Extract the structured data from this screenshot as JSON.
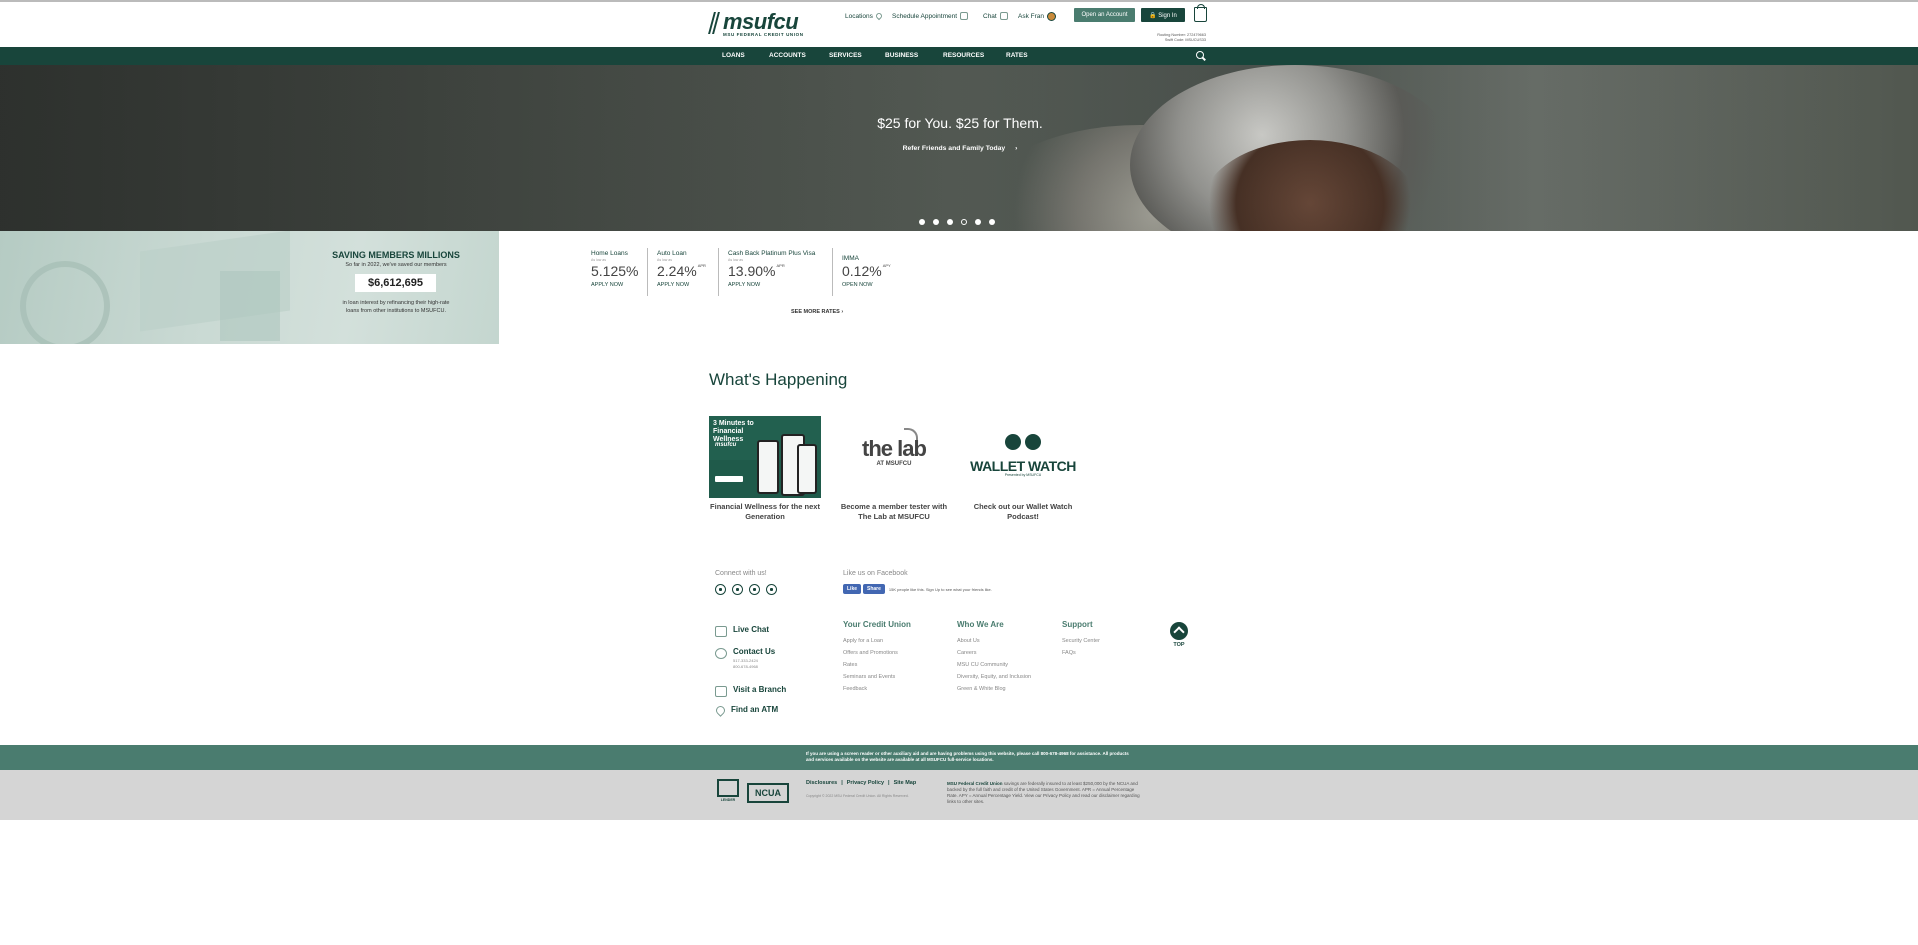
{
  "header": {
    "logo_word": "msufcu",
    "logo_sub": "MSU FEDERAL CREDIT UNION",
    "util": {
      "locations": "Locations",
      "schedule": "Schedule Appointment",
      "chat": "Chat",
      "ask_fran": "Ask Fran"
    },
    "open_account": "Open an Account",
    "sign_in": "🔒 Sign In",
    "routing": "Routing Number: 272479663",
    "swift": "Swift Code: MSUCUS33"
  },
  "nav": {
    "items": [
      "LOANS",
      "ACCOUNTS",
      "SERVICES",
      "BUSINESS",
      "RESOURCES",
      "RATES"
    ]
  },
  "hero": {
    "title": "$25 for You. $25 for Them.",
    "cta": "Refer Friends and Family Today",
    "cta_arrow": "›",
    "slides": 6,
    "active_slide": 4
  },
  "savings": {
    "title": "SAVING MEMBERS MILLIONS",
    "subtitle": "So far in 2022, we've saved our members",
    "amount": "$6,612,695",
    "description": "in loan interest by refinancing their high-rate loans from other institutions to MSUFCU."
  },
  "rates": [
    {
      "name": "Home Loans",
      "as_low_as": "As low as",
      "value": "5.125%",
      "suffix": "",
      "action": "APPLY NOW"
    },
    {
      "name": "Auto Loan",
      "as_low_as": "As low as",
      "value": "2.24%",
      "suffix": "APR",
      "action": "APPLY NOW"
    },
    {
      "name": "Cash Back Platinum Plus Visa",
      "as_low_as": "As low as",
      "value": "13.90%",
      "suffix": "APR",
      "action": "APPLY NOW"
    },
    {
      "name": "IMMA",
      "as_low_as": "",
      "value": "0.12%",
      "suffix": "APY",
      "action": "OPEN NOW"
    }
  ],
  "see_more": "SEE MORE RATES ›",
  "happening": {
    "title": "What's Happening",
    "cards": [
      {
        "caption": "Financial Wellness for the next Generation",
        "img_title": "3 Minutes to Financial Wellness",
        "img_brand": "msufcu"
      },
      {
        "caption": "Become a member tester with The Lab at MSUFCU",
        "img_title": "the lab",
        "img_sub": "AT MSUFCU"
      },
      {
        "caption": "Check out our Wallet Watch Podcast!",
        "img_title": "WALLET WATCH",
        "img_sub": "Presented by MSUFCU"
      }
    ]
  },
  "footer": {
    "connect": "Connect with us!",
    "fb_title": "Like us on Facebook",
    "fb_like": "Like",
    "fb_share": "Share",
    "fb_text": "15K people like this. Sign Up to see what your friends like.",
    "contacts": {
      "live_chat": "Live Chat",
      "contact_us": "Contact Us",
      "phone1": "517-333-2424",
      "phone2": "800-678-4968",
      "visit_branch": "Visit a Branch",
      "find_atm": "Find an ATM"
    },
    "columns": [
      {
        "heading": "Your Credit Union",
        "links": [
          "Apply for a Loan",
          "Offers and Promotions",
          "Rates",
          "Seminars and Events",
          "Feedback"
        ]
      },
      {
        "heading": "Who We Are",
        "links": [
          "About Us",
          "Careers",
          "MSU CU Community",
          "Diversity, Equity, and Inclusion",
          "Green & White Blog"
        ]
      },
      {
        "heading": "Support",
        "links": [
          "Security Center",
          "FAQs"
        ]
      }
    ],
    "top": "TOP",
    "accessibility": "If you are using a screen reader or other auxiliary aid and are having problems using this website, please call 800-678-4968 for assistance. All products and services available on the website are available at all MSUFCU full-service locations.",
    "legal_links": [
      "Disclosures",
      "Privacy Policy",
      "Site Map"
    ],
    "copyright": "Copyright © 2022 MSU Federal Credit Union. All Rights Reserved.",
    "insured_lead": "MSU Federal Credit Union",
    "insured_text": " savings are federally insured to at least $250,000 by the NCUA and backed by the full faith and credit of the United States Government. APR = Annual Percentage Rate. APY = Annual Percentage Yield. View our Privacy Policy and read our disclaimer regarding links to other sites.",
    "eho": "LENDER",
    "ncua": "NCUA"
  }
}
